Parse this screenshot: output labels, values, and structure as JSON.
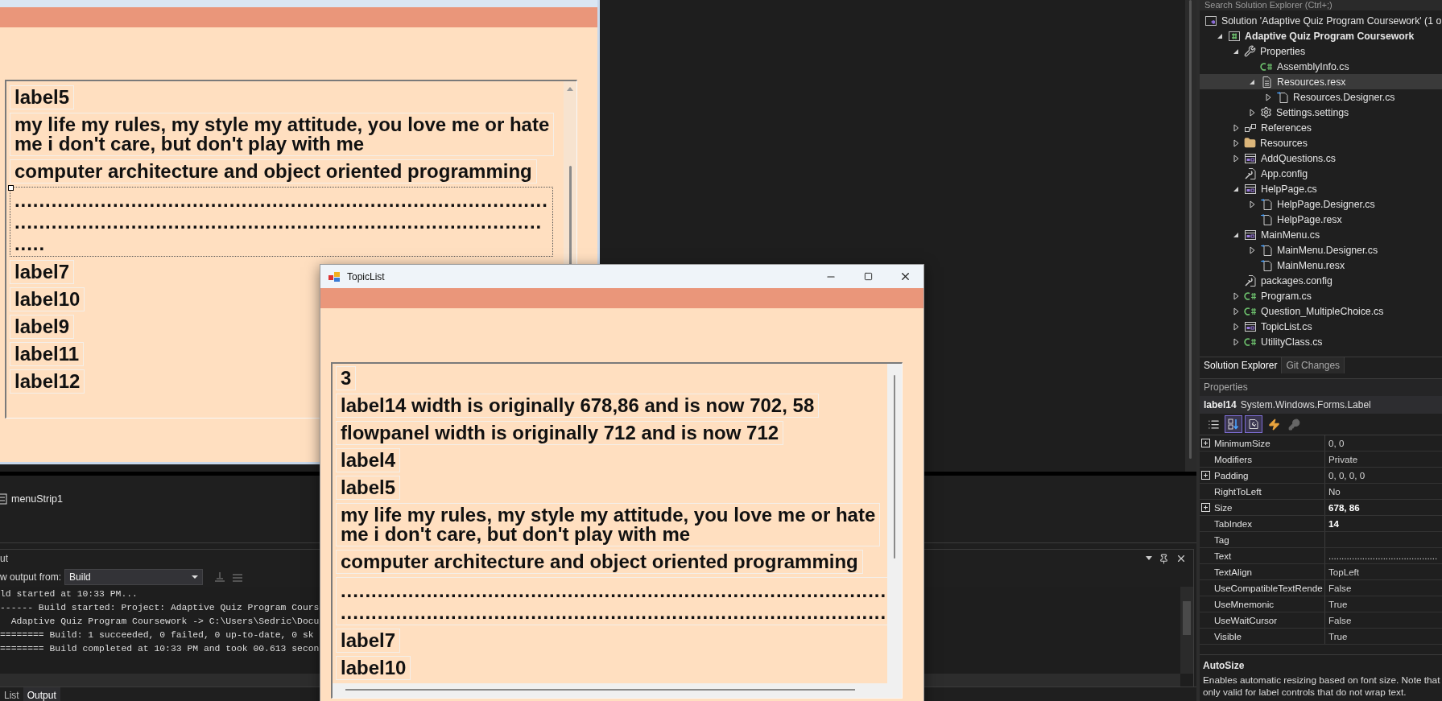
{
  "designer": {
    "labels": [
      {
        "kind": "text",
        "lines": [
          "label5"
        ],
        "selected": false
      },
      {
        "kind": "text",
        "lines": [
          "my life my rules, my style my attitude, you love me or hate",
          "me i don't care, but don't play with me"
        ],
        "selected": false
      },
      {
        "kind": "text",
        "lines": [
          "computer architecture and object oriented programming"
        ],
        "selected": false
      },
      {
        "kind": "dots",
        "lines": [
          ".......................................................................................",
          "......................................................................................",
          "....."
        ],
        "selected": true
      },
      {
        "kind": "text",
        "lines": [
          "label7"
        ],
        "selected": false
      },
      {
        "kind": "text",
        "lines": [
          "label10"
        ],
        "selected": false
      },
      {
        "kind": "text",
        "lines": [
          "label9"
        ],
        "selected": false
      },
      {
        "kind": "text",
        "lines": [
          "label11"
        ],
        "selected": false
      },
      {
        "kind": "text",
        "lines": [
          "label12"
        ],
        "selected": false
      }
    ],
    "component_tray": [
      "menuStrip1"
    ]
  },
  "output": {
    "title": "ut",
    "source_label": "w output from:",
    "source": "Build",
    "lines": [
      "ld started at 10:33 PM...",
      "------ Build started: Project: Adaptive Quiz Program Cours",
      "  Adaptive Quiz Program Coursework -> C:\\Users\\Sedric\\Docu",
      "======== Build: 1 succeeded, 0 failed, 0 up-to-date, 0 sk",
      "======== Build completed at 10:33 PM and took 00.613 secon"
    ]
  },
  "bottom_tabs": [
    {
      "label": "List",
      "selected": false
    },
    {
      "label": "Output",
      "selected": true
    }
  ],
  "solution_explorer": {
    "search": "Search Solution Explorer (Ctrl+;)",
    "tree": [
      {
        "kind": "solution",
        "label": "Solution 'Adaptive Quiz Program Coursework' (1 o",
        "selected": false,
        "children": [
          {
            "kind": "project",
            "label": "Adaptive Quiz Program Coursework",
            "expanded": true,
            "selected": false,
            "children": [
              {
                "kind": "wrench",
                "label": "Properties",
                "expanded": true,
                "selected": false,
                "children": [
                  {
                    "kind": "cs",
                    "label": "AssemblyInfo.cs",
                    "selected": false
                  },
                  {
                    "kind": "resx",
                    "label": "Resources.resx",
                    "expanded": true,
                    "selected": true,
                    "children": [
                      {
                        "kind": "designer",
                        "label": "Resources.Designer.cs",
                        "expanded": false,
                        "selected": false
                      }
                    ]
                  },
                  {
                    "kind": "gear",
                    "label": "Settings.settings",
                    "expanded": false,
                    "selected": false
                  }
                ]
              },
              {
                "kind": "references",
                "label": "References",
                "expanded": false,
                "selected": false
              },
              {
                "kind": "folder",
                "label": "Resources",
                "expanded": false,
                "selected": false
              },
              {
                "kind": "form",
                "label": "AddQuestions.cs",
                "expanded": false,
                "selected": false
              },
              {
                "kind": "config",
                "label": "App.config",
                "selected": false
              },
              {
                "kind": "form",
                "label": "HelpPage.cs",
                "expanded": true,
                "selected": false,
                "children": [
                  {
                    "kind": "designer",
                    "label": "HelpPage.Designer.cs",
                    "expanded": false,
                    "selected": false
                  },
                  {
                    "kind": "designer",
                    "label": "HelpPage.resx",
                    "selected": false
                  }
                ]
              },
              {
                "kind": "form",
                "label": "MainMenu.cs",
                "expanded": true,
                "selected": false,
                "children": [
                  {
                    "kind": "designer",
                    "label": "MainMenu.Designer.cs",
                    "expanded": false,
                    "selected": false
                  },
                  {
                    "kind": "designer",
                    "label": "MainMenu.resx",
                    "selected": false
                  }
                ]
              },
              {
                "kind": "config",
                "label": "packages.config",
                "selected": false
              },
              {
                "kind": "cs",
                "label": "Program.cs",
                "expanded": false,
                "selected": false
              },
              {
                "kind": "cs",
                "label": "Question_MultipleChoice.cs",
                "expanded": false,
                "selected": false
              },
              {
                "kind": "form",
                "label": "TopicList.cs",
                "expanded": false,
                "selected": false
              },
              {
                "kind": "cs",
                "label": "UtilityClass.cs",
                "expanded": false,
                "selected": false
              }
            ]
          }
        ]
      }
    ],
    "tabs": [
      {
        "label": "Solution Explorer",
        "selected": true
      },
      {
        "label": "Git Changes",
        "selected": false
      }
    ]
  },
  "properties": {
    "title": "Properties",
    "object": "label14",
    "type": "System.Windows.Forms.Label",
    "toolbar": [
      {
        "kind": "categorized",
        "selected": false,
        "disabled": false
      },
      {
        "kind": "alphabetical",
        "selected": true,
        "disabled": false
      },
      {
        "kind": "properties",
        "selected": true,
        "disabled": false
      },
      {
        "kind": "events",
        "selected": false,
        "disabled": false
      },
      {
        "kind": "pages",
        "selected": false,
        "disabled": true
      }
    ],
    "rows": [
      {
        "name": "MinimumSize",
        "value": "0, 0",
        "expandable": true,
        "modified": false
      },
      {
        "name": "Modifiers",
        "value": "Private",
        "expandable": false,
        "modified": false
      },
      {
        "name": "Padding",
        "value": "0, 0, 0, 0",
        "expandable": true,
        "modified": false
      },
      {
        "name": "RightToLeft",
        "value": "No",
        "expandable": false,
        "modified": false
      },
      {
        "name": "Size",
        "value": "678, 86",
        "expandable": true,
        "modified": true
      },
      {
        "name": "TabIndex",
        "value": "14",
        "expandable": false,
        "modified": true
      },
      {
        "name": "Tag",
        "expandable": false
      },
      {
        "name": "Text",
        "value": "..........................................",
        "expandable": false,
        "modified": false
      },
      {
        "name": "TextAlign",
        "value": "TopLeft",
        "expandable": false,
        "modified": false
      },
      {
        "name": "UseCompatibleTextRende",
        "value": "False",
        "expandable": false,
        "modified": false
      },
      {
        "name": "UseMnemonic",
        "value": "True",
        "expandable": false,
        "modified": false
      },
      {
        "name": "UseWaitCursor",
        "value": "False",
        "expandable": false,
        "modified": false
      },
      {
        "name": "Visible",
        "value": "True",
        "expandable": false,
        "modified": false
      }
    ],
    "description": {
      "title": "AutoSize",
      "lines": [
        "Enables automatic resizing based on font size. Note that",
        "only valid for label controls that do not wrap text."
      ]
    }
  },
  "topic_list_window": {
    "title": "TopicList",
    "labels": [
      {
        "kind": "text",
        "lines": [
          "3"
        ]
      },
      {
        "kind": "text",
        "lines": [
          "label14 width is originally 678,86 and is now 702, 58"
        ]
      },
      {
        "kind": "text",
        "lines": [
          "flowpanel width is originally 712 and is now 712"
        ]
      },
      {
        "kind": "text",
        "lines": [
          "label4"
        ]
      },
      {
        "kind": "text",
        "lines": [
          "label5"
        ]
      },
      {
        "kind": "text",
        "lines": [
          "my life my rules, my style my attitude, you love me or hate",
          "me i don't care, but don't play with me"
        ]
      },
      {
        "kind": "text",
        "lines": [
          "computer architecture and object oriented programming"
        ]
      },
      {
        "kind": "dots",
        "lines": [
          "..........................................................................................",
          "........................................................................................."
        ]
      },
      {
        "kind": "text",
        "lines": [
          "label7"
        ]
      },
      {
        "kind": "text",
        "lines": [
          "label10"
        ]
      }
    ]
  }
}
